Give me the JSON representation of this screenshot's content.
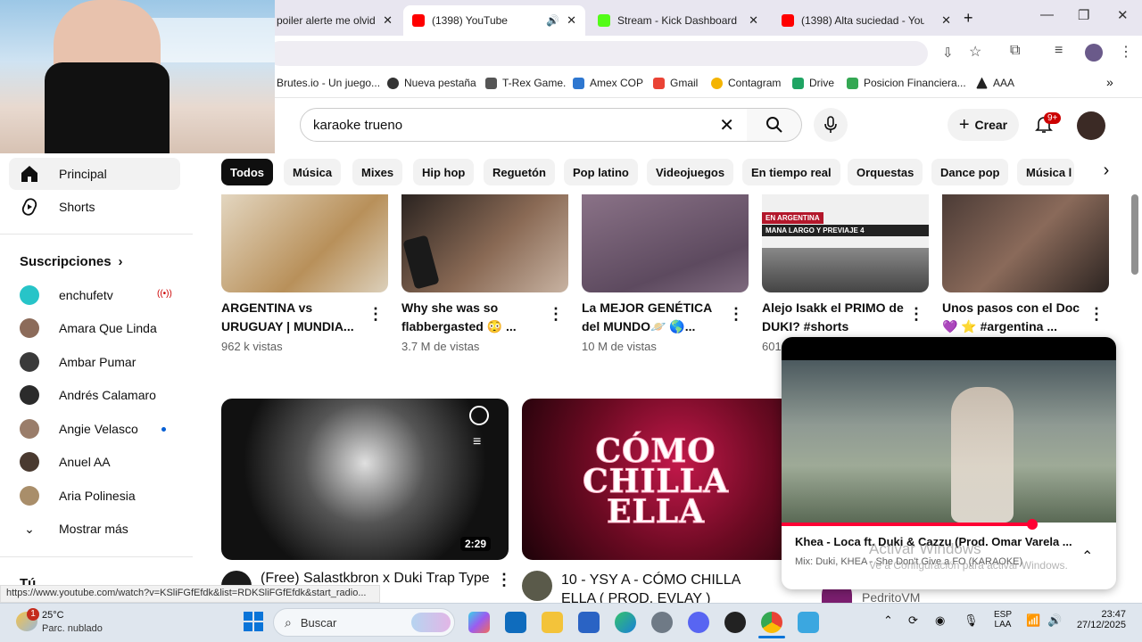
{
  "browser": {
    "tabs": [
      {
        "label": "poiler alerte me olvid",
        "color": "#d9443c"
      },
      {
        "label": "(1398) YouTube",
        "color": "#ff0000"
      },
      {
        "label": "Stream - Kick Dashboard",
        "color": "#53fc18"
      },
      {
        "label": "(1398) Alta suciedad - YouTu",
        "color": "#ff0000"
      }
    ],
    "new_tab": "+",
    "bookmarks": [
      {
        "label": "Brutes.io - Un juego...",
        "color": "#888888"
      },
      {
        "label": "Nueva pestaña",
        "color": "#333333"
      },
      {
        "label": "T-Rex Game.",
        "color": "#555555"
      },
      {
        "label": "Amex COP",
        "color": "#2e77d0"
      },
      {
        "label": "Gmail",
        "color": "#ea4335"
      },
      {
        "label": "Contagram",
        "color": "#f4b400"
      },
      {
        "label": "Drive",
        "color": "#1fa463"
      },
      {
        "label": "Posicion Financiera...",
        "color": "#34a853"
      },
      {
        "label": "AAA",
        "color": "#222222"
      }
    ],
    "status_url": "https://www.youtube.com/watch?v=KSliFGfEfdk&list=RDKSliFGfEfdk&start_radio..."
  },
  "youtube": {
    "search_value": "karaoke trueno",
    "create_label": "Crear",
    "notif_badge": "9+",
    "sidebar": {
      "home": "Principal",
      "shorts": "Shorts",
      "subs_header": "Suscripciones",
      "subscriptions": [
        {
          "name": "enchufetv",
          "color": "#27c4c8"
        },
        {
          "name": "Amara Que Linda",
          "color": "#8c6b5a"
        },
        {
          "name": "Ambar Pumar",
          "color": "#3a3a3a"
        },
        {
          "name": "Andrés Calamaro",
          "color": "#2b2b2b"
        },
        {
          "name": "Angie Velasco",
          "color": "#9a7d6a"
        },
        {
          "name": "Anuel AA",
          "color": "#4a3a30"
        },
        {
          "name": "Aria Polinesia",
          "color": "#a98e6a"
        }
      ],
      "show_more": "Mostrar más",
      "you": "Tú"
    },
    "chips": [
      "Todos",
      "Música",
      "Mixes",
      "Hip hop",
      "Reguetón",
      "Pop latino",
      "Videojuegos",
      "En tiempo real",
      "Orquestas",
      "Dance pop",
      "Música l"
    ],
    "shorts": [
      {
        "title": "ARGENTINA vs URUGUAY | MUNDIA...",
        "views": "962 k vistas",
        "color": "#cfc3b0"
      },
      {
        "title": "Why she was so flabbergasted 😳 ...",
        "views": "3.7 M de vistas",
        "color": "#5a4636"
      },
      {
        "title": "La MEJOR GENÉTICA del MUNDO🪐 🌎...",
        "views": "10 M de vistas",
        "color": "#7a6478"
      },
      {
        "title": "Alejo Isakk el PRIMO de DUKI? #shorts",
        "views": "601",
        "color": "#eeeeee"
      },
      {
        "title": "Unos pasos con el Doc 💜 ⭐ #argentina ...",
        "views": "",
        "color": "#4b3b36"
      }
    ],
    "short_overlay_text": [
      "EN ARGENTINA",
      "MANA LARGO Y PREVIAJE 4"
    ],
    "videos": [
      {
        "title": "(Free) Salastkbron x Duki Trap Type",
        "duration": "2:29",
        "color": "#2a2a2a"
      },
      {
        "title": "10 - YSY A - CÓMO CHILLA ELLA ( PROD. EVLAY )",
        "duration": "",
        "color": "#5c0a1e",
        "thumb_text": "CÓMO CHILLA ELLA"
      },
      {
        "title": "",
        "channel": "PedritoVM",
        "color": "#7a1e6e"
      }
    ],
    "miniplayer": {
      "title": "Khea - Loca ft. Duki & Cazzu (Prod. Omar Varela ...",
      "subtitle": "Mix: Duki, KHEA - She Don't Give a FO (KARAOKE)",
      "progress": 0.75,
      "watermark1": "Activar Windows",
      "watermark2": "Ve a Configuración para activar Windows."
    }
  },
  "taskbar": {
    "temp": "25°C",
    "weather": "Parc. nublado",
    "weather_badge": "1",
    "search": "Buscar",
    "lang": "ESP",
    "lang2": "LAA",
    "time": "23:47",
    "date": "27/12/2025"
  }
}
